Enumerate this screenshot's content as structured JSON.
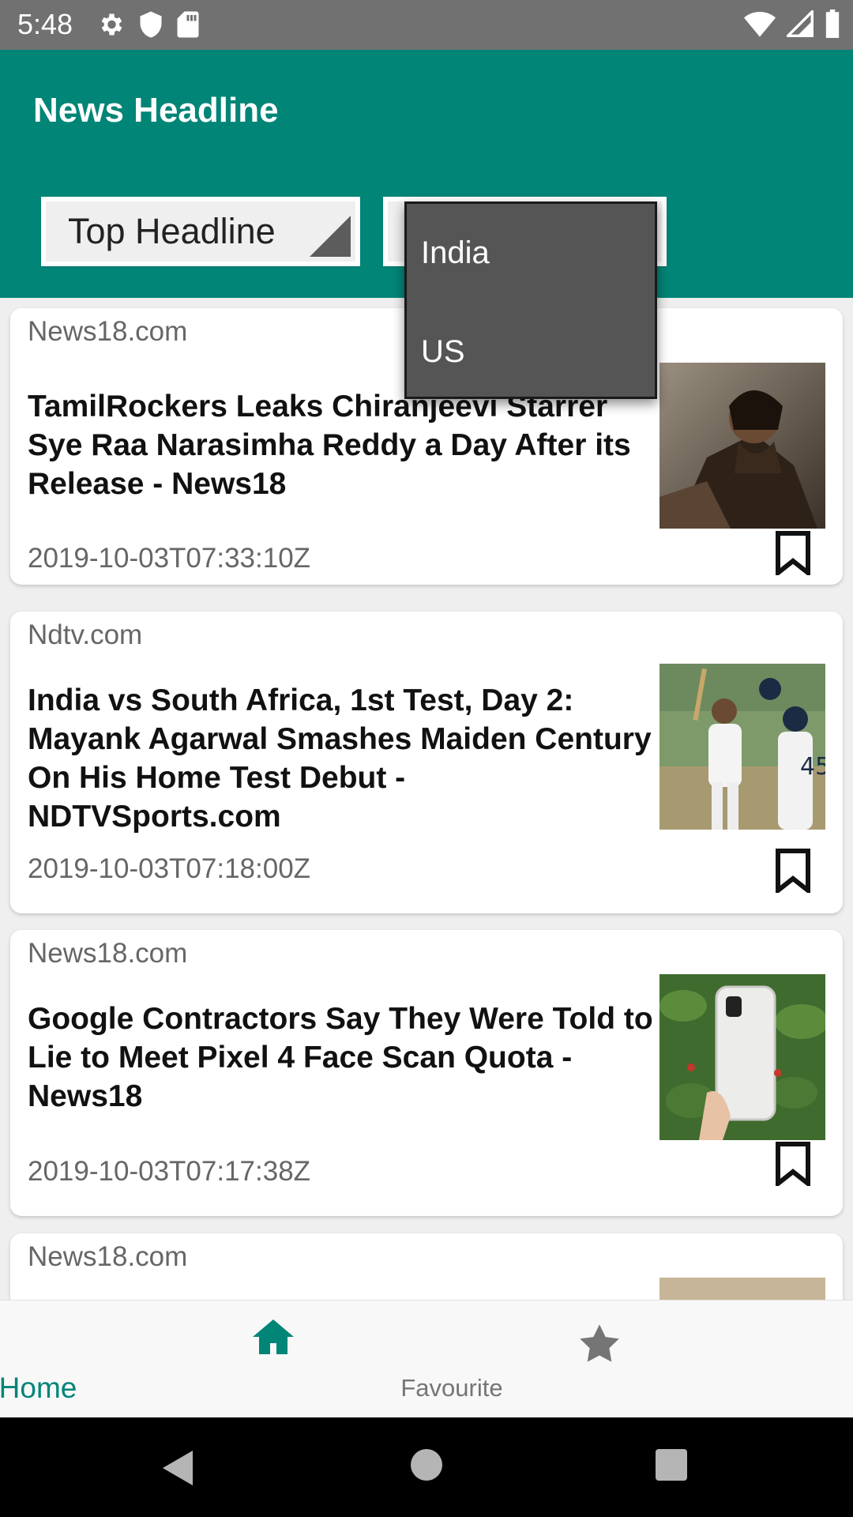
{
  "status_bar": {
    "time": "5:48",
    "left_icons": [
      "settings-icon",
      "shield-icon",
      "sd-card-icon"
    ],
    "right_icons": [
      "wifi-icon",
      "signal-icon",
      "battery-icon"
    ]
  },
  "app_bar": {
    "title": "News Headline",
    "background": "#008577"
  },
  "spinners": {
    "category": {
      "selected": "Top Headline"
    },
    "country": {
      "open": true,
      "options": [
        "India",
        "US"
      ]
    }
  },
  "articles": [
    {
      "source": "News18.com",
      "title": "TamilRockers Leaks Chiranjeevi Starrer Sye Raa Narasimha Reddy a Day After its Release - News18",
      "date": "2019-10-03T07:33:10Z",
      "image": "movie-poster-image",
      "bookmark_icon": "bookmark-outline-icon"
    },
    {
      "source": "Ndtv.com",
      "title": "India vs South Africa, 1st Test, Day 2: Mayank Agarwal Smashes Maiden Century On His Home Test Debut - NDTVSports.com",
      "date": "2019-10-03T07:18:00Z",
      "image": "cricket-players-image",
      "bookmark_icon": "bookmark-outline-icon"
    },
    {
      "source": "News18.com",
      "title": "Google Contractors Say They Were Told to Lie to Meet Pixel 4 Face Scan Quota - News18",
      "date": "2019-10-03T07:17:38Z",
      "image": "pixel-phone-image",
      "bookmark_icon": "bookmark-outline-icon"
    },
    {
      "source": "News18.com",
      "image": "partial-thumbnail-image"
    }
  ],
  "bottom_nav": {
    "items": [
      {
        "label": "Home",
        "icon": "home-icon",
        "active": true,
        "color": "#008577"
      },
      {
        "label": "Favourite",
        "icon": "star-icon",
        "active": false,
        "color": "#757575"
      }
    ]
  },
  "system_nav": [
    "back-icon",
    "home-circle-icon",
    "recents-icon"
  ]
}
